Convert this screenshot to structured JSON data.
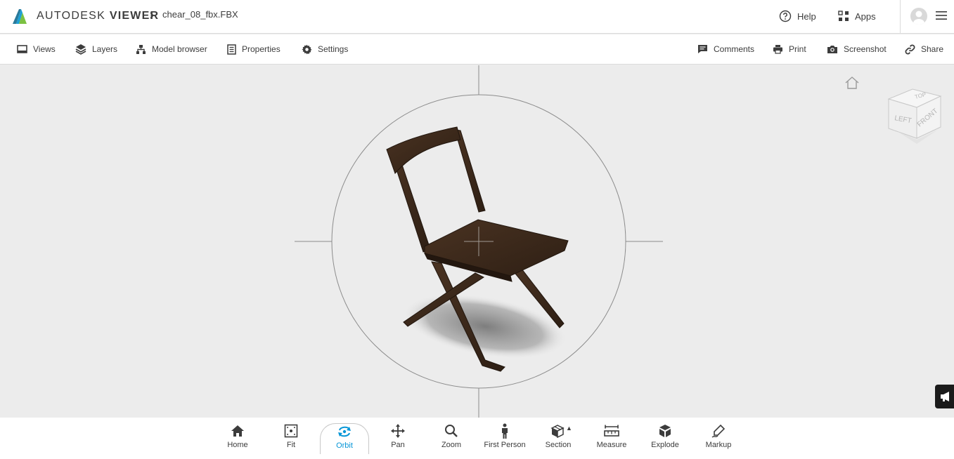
{
  "header": {
    "brand_light": "AUTODESK",
    "brand_bold": "VIEWER",
    "file_name": "chear_08_fbx.FBX",
    "help_label": "Help",
    "apps_label": "Apps"
  },
  "toolbar": {
    "left": [
      {
        "label": "Views",
        "icon": "views-icon"
      },
      {
        "label": "Layers",
        "icon": "layers-icon"
      },
      {
        "label": "Model browser",
        "icon": "model-browser-icon"
      },
      {
        "label": "Properties",
        "icon": "properties-icon"
      },
      {
        "label": "Settings",
        "icon": "gear-icon"
      }
    ],
    "right": [
      {
        "label": "Comments",
        "icon": "comment-icon"
      },
      {
        "label": "Print",
        "icon": "printer-icon"
      },
      {
        "label": "Screenshot",
        "icon": "camera-icon"
      },
      {
        "label": "Share",
        "icon": "link-icon"
      }
    ]
  },
  "viewcube": {
    "faces": [
      "TOP",
      "LEFT",
      "FRONT"
    ]
  },
  "tools": [
    {
      "label": "Home",
      "icon": "home-icon",
      "active": false
    },
    {
      "label": "Fit",
      "icon": "fit-icon",
      "active": false
    },
    {
      "label": "Orbit",
      "icon": "orbit-icon",
      "active": true
    },
    {
      "label": "Pan",
      "icon": "pan-icon",
      "active": false
    },
    {
      "label": "Zoom",
      "icon": "zoom-icon",
      "active": false
    },
    {
      "label": "First Person",
      "icon": "person-icon",
      "active": false
    },
    {
      "label": "Section",
      "icon": "section-icon",
      "active": false,
      "has_menu": true
    },
    {
      "label": "Measure",
      "icon": "measure-icon",
      "active": false
    },
    {
      "label": "Explode",
      "icon": "explode-icon",
      "active": false
    },
    {
      "label": "Markup",
      "icon": "markup-icon",
      "active": false
    }
  ],
  "colors": {
    "accent": "#0696d7",
    "viewport_bg": "#ececec",
    "chair_wood": "#3d2a1c"
  }
}
